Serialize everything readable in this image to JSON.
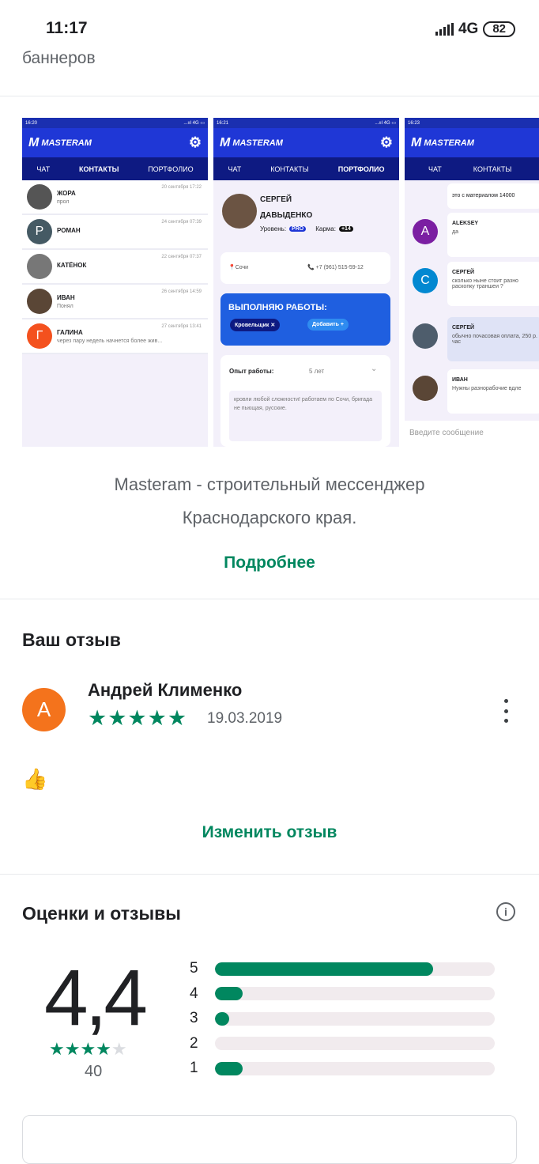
{
  "status": {
    "time": "11:17",
    "network": "4G",
    "battery": "82"
  },
  "top_text": "баннеров",
  "screenshots": {
    "brand": "MASTERAM",
    "tabs": [
      "ЧАТ",
      "КОНТАКТЫ",
      "ПОРТФОЛИО"
    ],
    "shot1": {
      "contacts": [
        {
          "name": "ЖОРА",
          "msg": "прол",
          "date": "20 сентября 17:22",
          "initial": "",
          "color": "#555"
        },
        {
          "name": "РОМАН",
          "msg": "",
          "date": "24 сентября 07:39",
          "initial": "Р",
          "color": "#455a64"
        },
        {
          "name": "КАТЁНОК",
          "msg": "",
          "date": "22 сентября 07:37",
          "initial": "",
          "color": "#777"
        },
        {
          "name": "ИВАН",
          "msg": "Понял",
          "date": "26 сентября 14:59",
          "initial": "",
          "color": "#5a4636"
        },
        {
          "name": "ГАЛИНА",
          "msg": "через пару недель начнется более жив...",
          "date": "27 сентября 13:41",
          "initial": "Г",
          "color": "#f4511e"
        }
      ]
    },
    "shot2": {
      "name_line1": "СЕРГЕЙ",
      "name_line2": "ДАВЫДЕНКО",
      "level_label": "Уровень:",
      "level": "PRO",
      "karma_label": "Карма:",
      "karma": "+14",
      "city": "Сочи",
      "phone": "+7 (961) 515-59-12",
      "works_title": "ВЫПОЛНЯЮ РАБОТЫ:",
      "work_chip": "Кровельщик",
      "add_label": "Добавить",
      "exp_label": "Опыт работы:",
      "exp_value": "5 лет",
      "about": "кровли любой сложности! работаем по Сочи, бригада не пьющая, русские."
    },
    "shot3": {
      "top_msg": "это с материалом 14000",
      "messages": [
        {
          "name": "ALEKSEY",
          "text": "да",
          "initial": "A",
          "color": "#7b1fa2"
        },
        {
          "name": "СЕРГЕЙ",
          "text": "сколько ныне стоит разно раскопку траншеи ?",
          "initial": "С",
          "color": "#0288d1"
        },
        {
          "name": "СЕРГЕЙ",
          "text": "обычно почасовая оплата, 250 р. час",
          "initial": "",
          "color": "#4e5d6c"
        },
        {
          "name": "ИВАН",
          "text": "Нужны разнорабочие вдле",
          "initial": "",
          "color": "#5a4636"
        }
      ],
      "input_placeholder": "Введите сообщение"
    }
  },
  "description_line1": "Masteram - строительный мессенджер",
  "description_line2": "Краснодарского края.",
  "more_label": "Подробнее",
  "your_review": {
    "title": "Ваш отзыв",
    "avatar_initial": "А",
    "author": "Андрей Клименко",
    "stars": "★★★★★",
    "date": "19.03.2019",
    "body": "👍",
    "edit_label": "Изменить отзыв"
  },
  "ratings": {
    "title": "Оценки и отзывы",
    "average": "4,4",
    "stars": "★★★★",
    "total": "40",
    "bars": [
      {
        "label": "5",
        "fraction": 0.78
      },
      {
        "label": "4",
        "fraction": 0.1
      },
      {
        "label": "3",
        "fraction": 0.05
      },
      {
        "label": "2",
        "fraction": 0
      },
      {
        "label": "1",
        "fraction": 0.1
      }
    ]
  }
}
